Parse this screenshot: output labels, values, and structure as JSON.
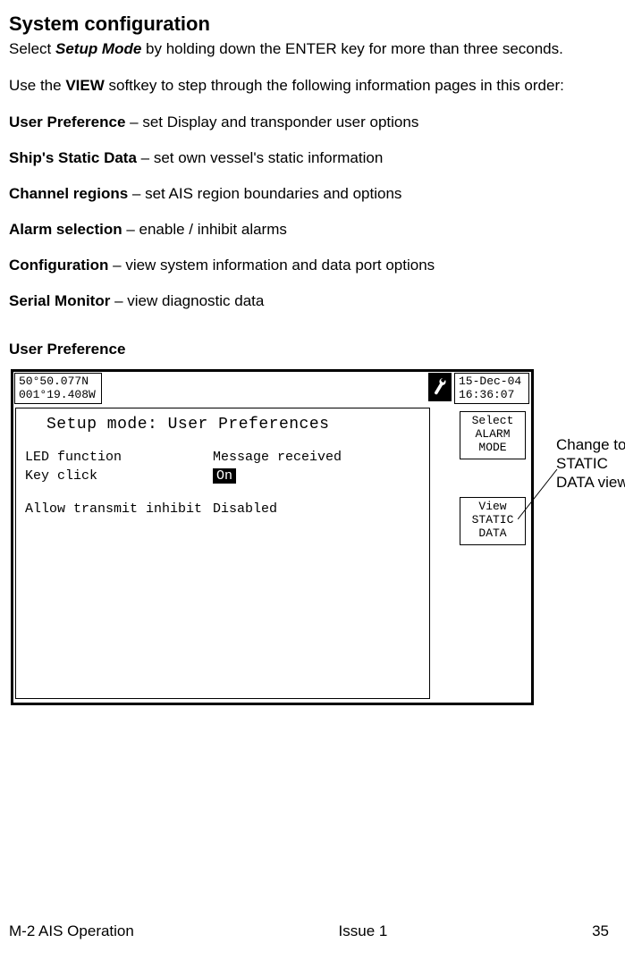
{
  "heading": "System configuration",
  "intro1_a": "Select ",
  "intro1_b": "Setup Mode",
  "intro1_c": " by holding down the ENTER key for more than three seconds.",
  "intro2_a": "Use the ",
  "intro2_b": "VIEW",
  "intro2_c": " softkey to step through the following information pages in this order:",
  "items": [
    {
      "label": "User Preference",
      "desc": " – set Display and transponder user options"
    },
    {
      "label": "Ship's Static Data",
      "desc": " – set own vessel's static information"
    },
    {
      "label": "Channel regions",
      "desc": " – set AIS region boundaries and options"
    },
    {
      "label": "Alarm selection",
      "desc": " – enable / inhibit alarms"
    },
    {
      "label": "Configuration",
      "desc": " – view system information and data port options"
    },
    {
      "label": "Serial Monitor",
      "desc": " – view diagnostic data"
    }
  ],
  "section_title": "User Preference",
  "screen": {
    "coord_line1": "50°50.077N",
    "coord_line2": "001°19.408W",
    "date_line1": "15-Dec-04",
    "date_line2": "16:36:07",
    "panel_title": "Setup mode: User Preferences",
    "rows": [
      {
        "label": "LED function",
        "value": "Message received",
        "hl": false
      },
      {
        "label": "Key click",
        "value": "On",
        "hl": true
      }
    ],
    "row_spacer_label": "Allow transmit inhibit",
    "row_spacer_value": "Disabled",
    "softkey1_l1": "Select",
    "softkey1_l2": "ALARM",
    "softkey1_l3": "MODE",
    "softkey2_l1": "View",
    "softkey2_l2": "STATIC",
    "softkey2_l3": "DATA"
  },
  "annotation": "Change to STATIC DATA view",
  "footer": {
    "left": "M-2 AIS Operation",
    "center": "Issue 1",
    "right": "35"
  }
}
